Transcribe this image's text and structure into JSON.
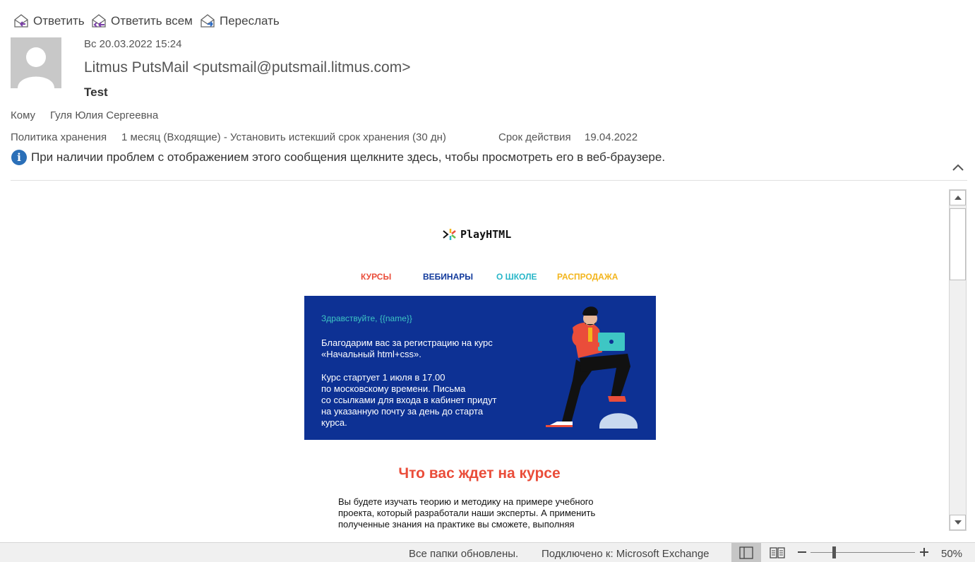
{
  "toolbar": {
    "reply": "Ответить",
    "reply_all": "Ответить всем",
    "forward": "Переслать"
  },
  "message": {
    "date": "Вс 20.03.2022 15:24",
    "sender": "Litmus PutsMail <putsmail@putsmail.litmus.com>",
    "subject": "Test",
    "to_label": "Кому",
    "to_value": "Гуля Юлия Сергеевна",
    "retention_label": "Политика хранения",
    "retention_value": "1 месяц (Входящие) - Установить истекший срок хранения (30 дн)",
    "expiry_label": "Срок действия",
    "expiry_value": "19.04.2022",
    "info_text": "При наличии проблем с отображением этого сообщения щелкните здесь, чтобы просмотреть его в веб-браузере."
  },
  "email": {
    "logo": "PlayHTML",
    "nav": [
      {
        "label": "КУРСЫ",
        "color": "#ea4d3a"
      },
      {
        "label": "ВЕБИНАРЫ",
        "color": "#123a9c"
      },
      {
        "label": "О ШКОЛЕ",
        "color": "#28b6c8"
      },
      {
        "label": "РАСПРОДАЖА",
        "color": "#f3b51c"
      }
    ],
    "greeting": "Здравствуйте, {{name}}",
    "paragraph1": "Благодарим вас за регистрацию на курс\n«Начальный html+css».",
    "paragraph2": "Курс стартует 1 июля в 17.00\nпо московскому времени. Письма\nсо ссылками для входа в кабинет придут\nна указанную почту за день до старта\nкурса.",
    "section_title": "Что вас ждет на курсе",
    "section_text": "Вы будете изучать теорию и методику на примере учебного\nпроекта, который разработали наши эксперты. А применить\nполученные знания на практике вы сможете, выполняя"
  },
  "status_bar": {
    "folders": "Все папки обновлены.",
    "connection": "Подключено к: Microsoft Exchange",
    "zoom": "50%"
  },
  "colors": {
    "hero_bg": "#0d3194",
    "accent_red": "#ea4d3a",
    "teal": "#3ec6c4"
  }
}
